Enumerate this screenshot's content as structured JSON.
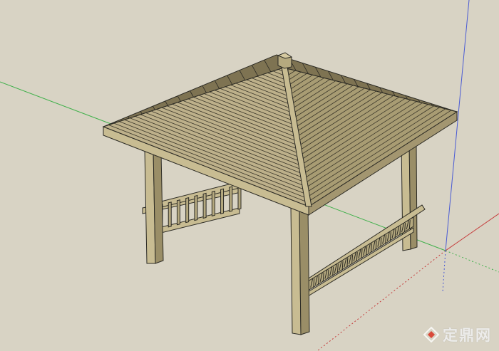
{
  "watermark": {
    "text": "定鼎网"
  },
  "colors": {
    "background": "#d8d3c4",
    "axis_red": "#c53a3a",
    "axis_green": "#3fb04a",
    "axis_blue": "#4a5bd4",
    "roof_light": "#bdb08a",
    "roof_mid": "#a39670",
    "roof_dark": "#7e7352",
    "wood": "#c8bc92",
    "wood_dark": "#9a8e67",
    "edge": "#2b2a24"
  },
  "icons": {
    "watermark_logo": "logo-icon"
  }
}
